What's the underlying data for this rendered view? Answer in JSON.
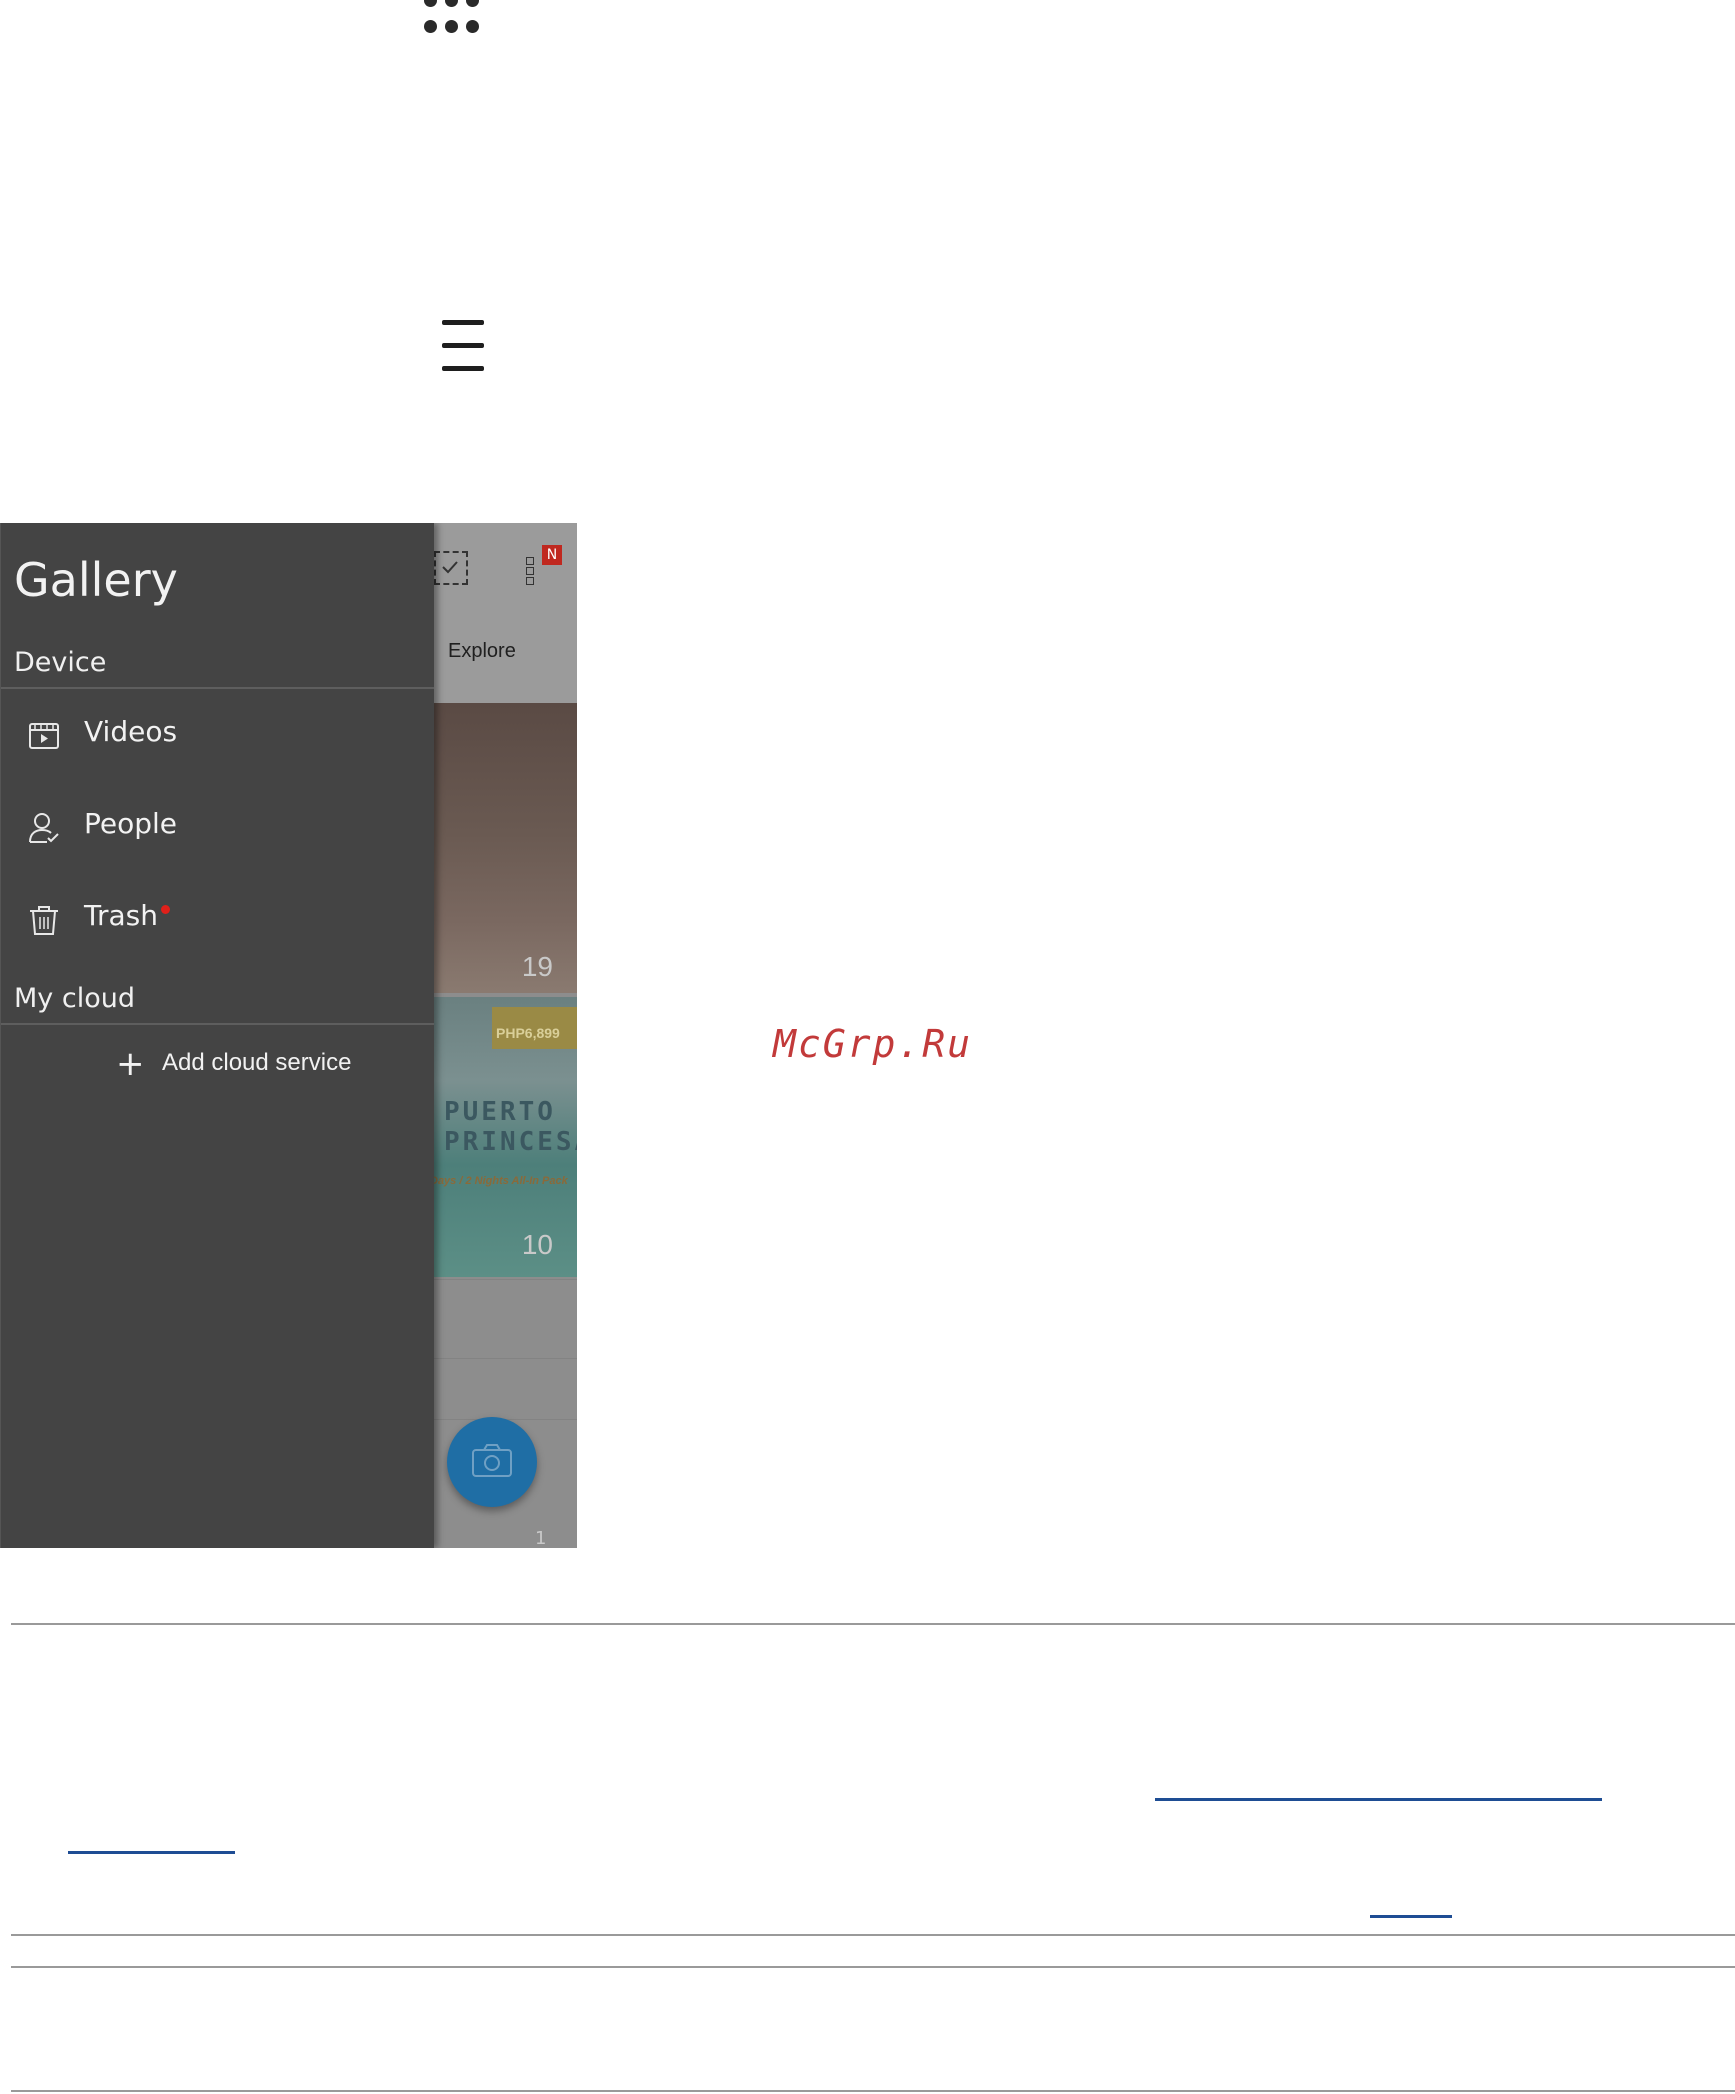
{
  "icons": {
    "apps": "all-apps-icon",
    "menu": "hamburger-menu-icon"
  },
  "phone": {
    "drawer": {
      "title": "Gallery",
      "device_section": "Device",
      "items": [
        {
          "label": "Videos",
          "icon": "video-icon"
        },
        {
          "label": "People",
          "icon": "person-icon"
        },
        {
          "label": "Trash",
          "icon": "trash-icon",
          "badge": "red-dot"
        }
      ],
      "cloud_section": "My cloud",
      "add_cloud_label": "Add cloud service"
    },
    "background": {
      "tab_label": "Explore",
      "badge_label": "N",
      "tiles": [
        {
          "count": "19"
        },
        {
          "count": "10",
          "promo_tag": "PHP6,899",
          "promo_title": "PUERTO PRINCESA",
          "promo_sub": "Days / 2 Nights All-In Pack"
        }
      ],
      "bottom_count": "1"
    }
  },
  "watermark": "McGrp.Ru",
  "colors": {
    "drawer_bg": "#444444",
    "fab": "#1f6ea5",
    "link": "#1e4d94",
    "badge": "#c0281f",
    "watermark": "#c23a3a"
  }
}
